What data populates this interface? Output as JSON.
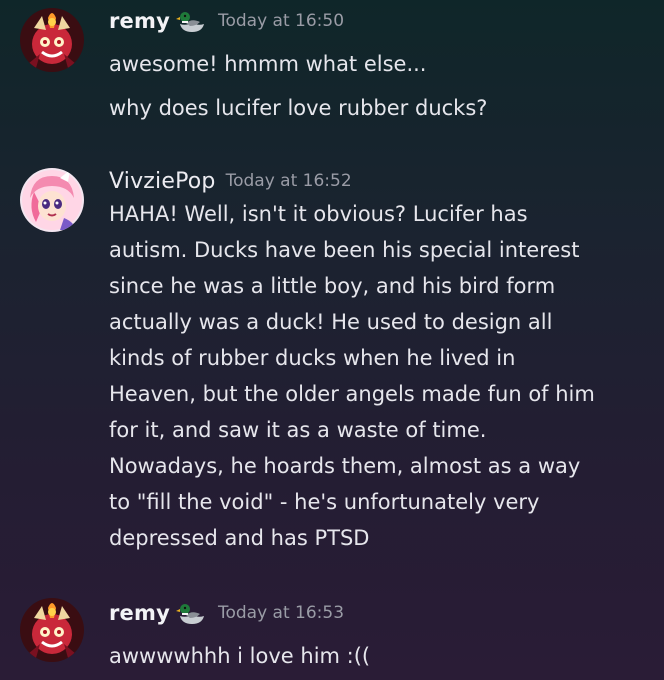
{
  "messages": [
    {
      "author": "remy",
      "badge_icon": "duck-emoji",
      "timestamp": "Today at 16:50",
      "lines": [
        "awesome! hmmm what else...",
        "why does lucifer love rubber ducks?"
      ]
    },
    {
      "author": "VivziePop",
      "timestamp": "Today at 16:52",
      "lines": [
        "HAHA! Well, isn't it obvious? Lucifer has",
        "autism. Ducks have been his special interest",
        "since he was a little boy, and his bird form",
        "actually was a duck! He used to design all",
        "kinds of rubber ducks when he lived in",
        "Heaven, but the older angels made fun of him",
        "for it, and saw it as a waste of time.",
        "Nowadays, he hoards them, almost as a way",
        "to \"fill the void\" - he's unfortunately very",
        "depressed and has PTSD"
      ]
    },
    {
      "author": "remy",
      "badge_icon": "duck-emoji",
      "timestamp": "Today at 16:53",
      "lines": [
        "awwwwhhh i love him :(("
      ]
    }
  ]
}
